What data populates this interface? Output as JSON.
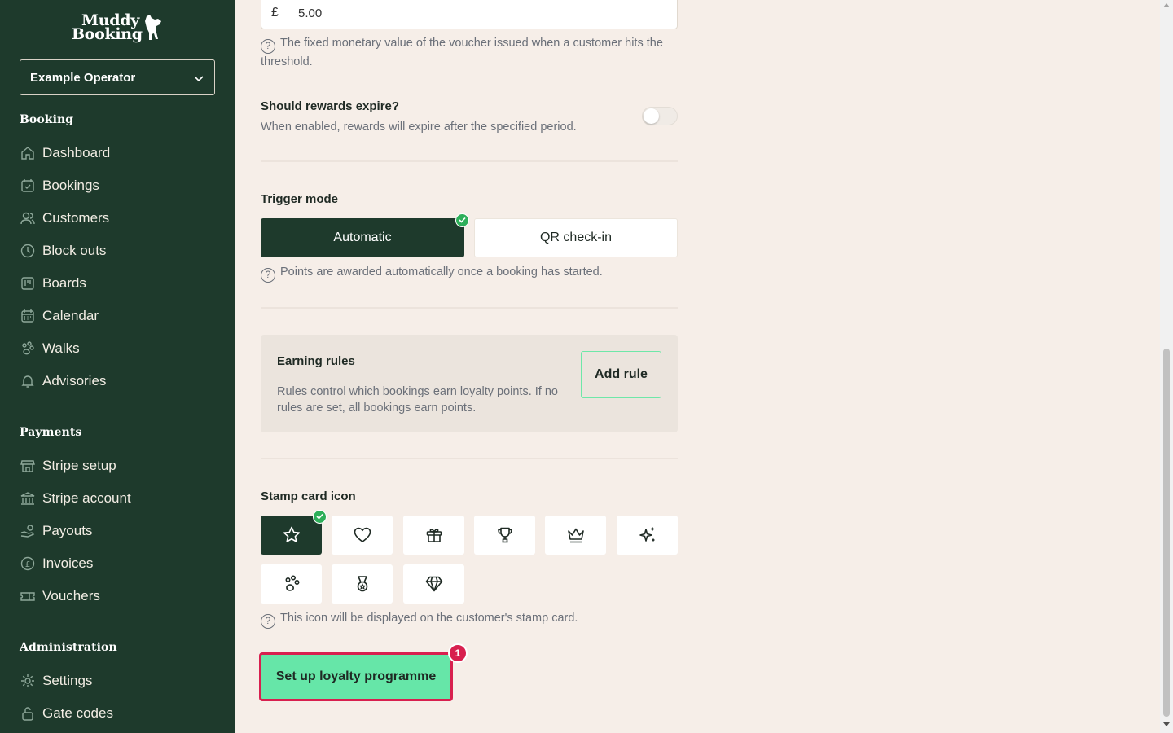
{
  "sidebar": {
    "logo": {
      "line1": "Muddy",
      "line2": "Booking"
    },
    "operator": {
      "selected": "Example Operator"
    },
    "sections": {
      "booking": "Booking",
      "payments": "Payments",
      "administration": "Administration"
    },
    "items": {
      "dashboard": "Dashboard",
      "bookings": "Bookings",
      "customers": "Customers",
      "block_outs": "Block outs",
      "boards": "Boards",
      "calendar": "Calendar",
      "walks": "Walks",
      "advisories": "Advisories",
      "stripe_setup": "Stripe setup",
      "stripe_account": "Stripe account",
      "payouts": "Payouts",
      "invoices": "Invoices",
      "vouchers": "Vouchers",
      "settings": "Settings",
      "gate_codes": "Gate codes"
    }
  },
  "form": {
    "voucher_value": {
      "currency": "£",
      "value": "5.00",
      "help": "The fixed monetary value of the voucher issued when a customer hits the threshold."
    },
    "expire": {
      "label": "Should rewards expire?",
      "description": "When enabled, rewards will expire after the specified period.",
      "enabled": false
    },
    "trigger": {
      "label": "Trigger mode",
      "options": [
        "Automatic",
        "QR check-in"
      ],
      "selected": "Automatic",
      "help": "Points are awarded automatically once a booking has started."
    },
    "earning_rules": {
      "title": "Earning rules",
      "description": "Rules control which bookings earn loyalty points. If no rules are set, all bookings earn points.",
      "add_label": "Add rule"
    },
    "stamp_icon": {
      "label": "Stamp card icon",
      "options": [
        "star-icon",
        "heart-icon",
        "gift-icon",
        "trophy-icon",
        "crown-icon",
        "sparkles-icon",
        "paw-icon",
        "medal-icon",
        "diamond-icon"
      ],
      "selected": "star-icon",
      "help": "This icon will be displayed on the customer's stamp card."
    },
    "submit": {
      "label": "Set up loyalty programme",
      "badge": "1"
    }
  },
  "colors": {
    "sidebar_bg": "#1e3a2c",
    "page_bg": "#f6eee8",
    "accent_green": "#66e6a8",
    "highlight_red": "#d8204f",
    "check_green": "#2eaf5a"
  }
}
